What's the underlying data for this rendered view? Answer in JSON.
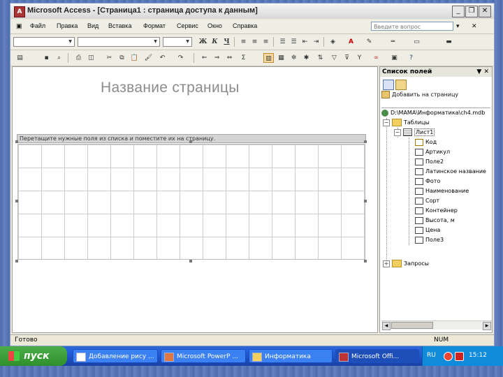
{
  "window": {
    "title": "Microsoft Access - [Страница1 : страница доступа к данным]",
    "controls": {
      "minimize": "_",
      "restore": "❐",
      "close": "✕"
    }
  },
  "menu": {
    "items": [
      "Файл",
      "Правка",
      "Вид",
      "Вставка",
      "Формат",
      "Сервис",
      "Окно",
      "Справка"
    ],
    "ask_placeholder": "Введите вопрос"
  },
  "toolbar_format": {
    "bold": "Ж",
    "italic": "К",
    "underline": "Ч"
  },
  "canvas": {
    "page_title": "Название страницы",
    "section_hint": "Перетащите нужные поля из списка и поместите их на страницу."
  },
  "field_list": {
    "header": "Список полей",
    "header_buttons": "▼ ✕",
    "add_to_page": "Добавить на страницу",
    "tree": {
      "database": "D:\\MAMA\\Информатика\\ch4.mdb",
      "tables_label": "Таблицы",
      "sheet_label": "Лист1",
      "fields": [
        "Код",
        "Артикул",
        "Поле2",
        "Латинское название",
        "Фото",
        "Наименование",
        "Сорт",
        "Контейнер",
        "Высота, м",
        "Цена",
        "Поле3"
      ],
      "queries_label": "Запросы"
    }
  },
  "status": {
    "left": "Готово",
    "right": "NUM"
  },
  "taskbar": {
    "start_label": "пуск",
    "tasks": [
      "Добавление рису ...",
      "Microsoft PowerP ...",
      "Информатика",
      "Microsoft Offi..."
    ],
    "lang": "RU",
    "clock": "15:12"
  }
}
